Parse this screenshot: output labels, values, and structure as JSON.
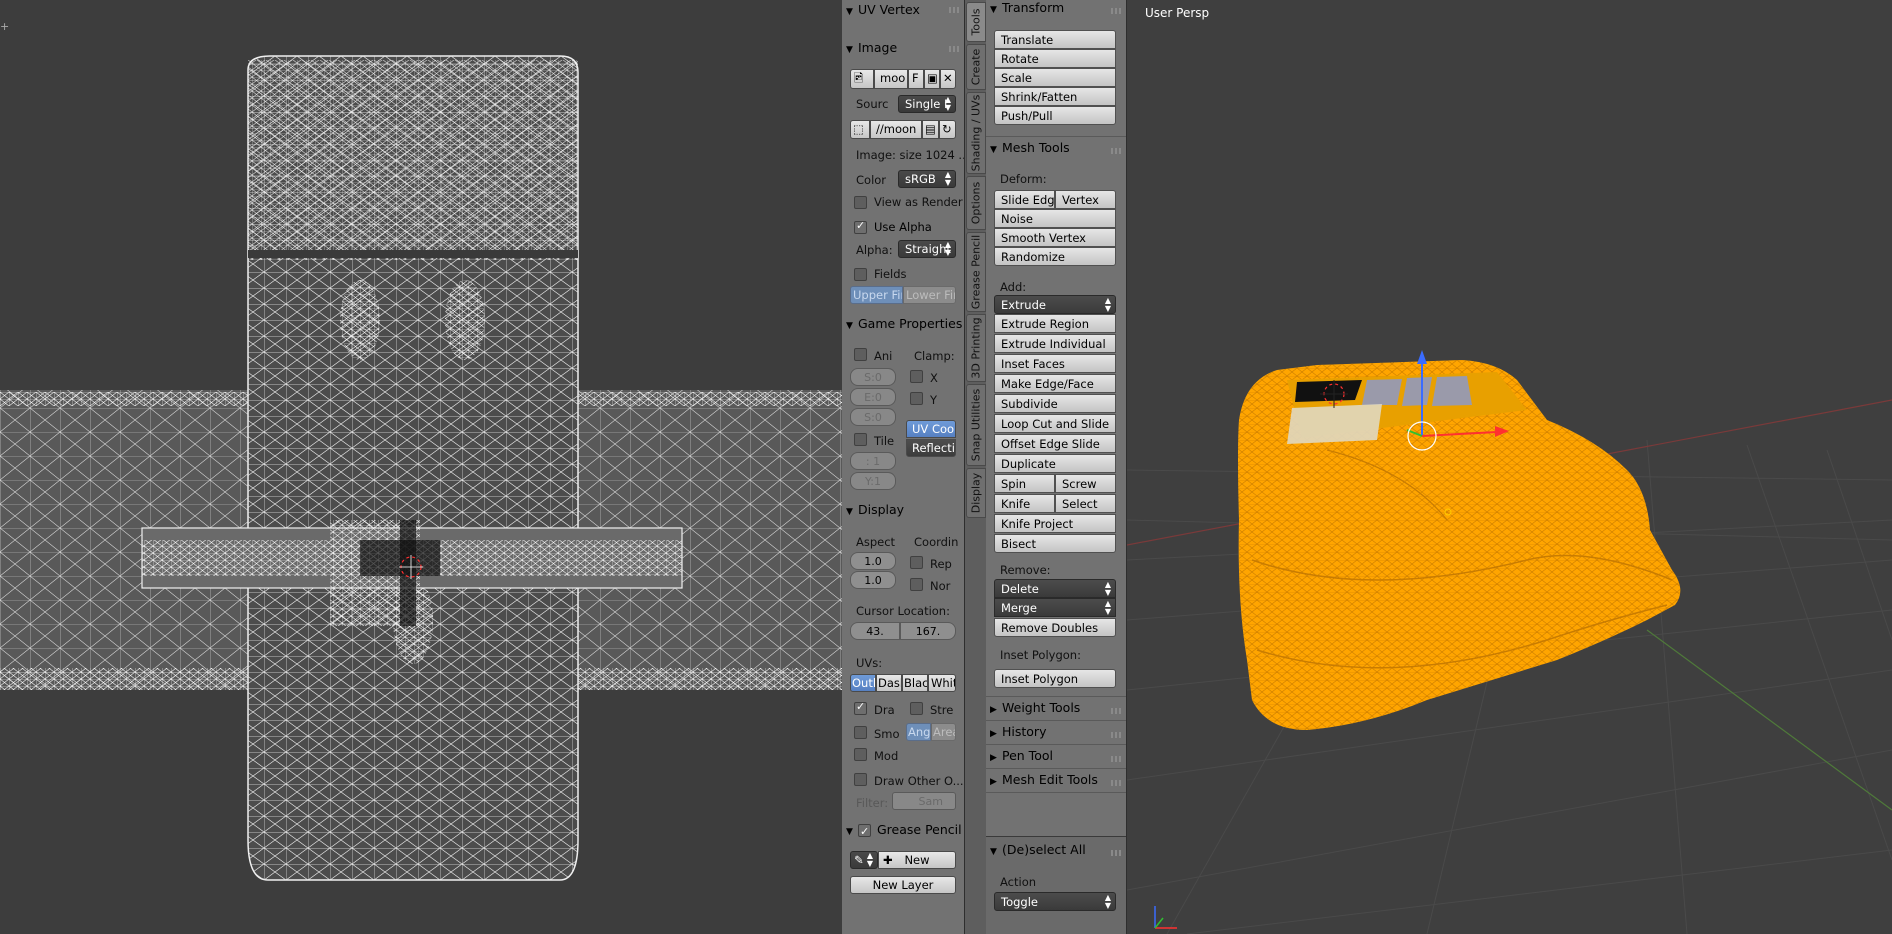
{
  "uv_panel": {
    "uv_vertex_title": "UV Vertex",
    "image_title": "Image",
    "image_name": "moo",
    "image_fake_user": "F",
    "source_label": "Sourc",
    "source_value": "Single I",
    "filepath": "//moon",
    "image_info": "Image: size 1024 ...",
    "color_label": "Color",
    "color_value": "sRGB",
    "view_as_render": "View as Render",
    "use_alpha": "Use Alpha",
    "alpha_label": "Alpha:",
    "alpha_value": "Straight",
    "fields": "Fields",
    "upper_first": "Upper Firs",
    "lower_first": "Lower Firs",
    "game_properties_title": "Game Properties",
    "animated": "Ani",
    "clamp_label": "Clamp:",
    "start_field": "S:0",
    "end_field": "E:0",
    "speed_field": "S:0",
    "clamp_x": "X",
    "clamp_y": "Y",
    "uv_coordinates": "UV Coo",
    "reflection": "Reflecti",
    "tiles": "Tile",
    "tile_x": ": 1",
    "tile_y": "Y:1",
    "display_title": "Display",
    "aspect_label": "Aspect",
    "aspect_x": "1.0",
    "aspect_y": "1.0",
    "coordinates_label": "Coordin",
    "repeat": "Rep",
    "normalized": "Nor",
    "cursor_location_label": "Cursor Location:",
    "cursor_x": "43.",
    "cursor_y": "167.",
    "uvs_label": "UVs:",
    "uv_outline": "Outl",
    "uv_dash": "Dash",
    "uv_black": "Blac",
    "uv_white": "Whit",
    "draw_faces": "Dra",
    "stretch": "Stre",
    "smooth": "Smo",
    "angle": "Angl",
    "area": "Area",
    "modified": "Mod",
    "draw_other_objects": "Draw Other O...",
    "filter_label": "Filter:",
    "filter_value": "Sam",
    "grease_pencil_title": "Grease Pencil",
    "new_button": "New",
    "new_layer_button": "New Layer"
  },
  "tabs": [
    "Tools",
    "Create",
    "Shading / UVs",
    "Options",
    "Grease Pencil",
    "3D Printing",
    "Snap Utilities",
    "Display"
  ],
  "tool_shelf": {
    "transform_title": "Transform",
    "translate": "Translate",
    "rotate": "Rotate",
    "scale": "Scale",
    "shrink_fatten": "Shrink/Fatten",
    "push_pull": "Push/Pull",
    "mesh_tools_title": "Mesh Tools",
    "deform_label": "Deform:",
    "slide_edge": "Slide Edge",
    "vertex": "Vertex",
    "noise": "Noise",
    "smooth_vertex": "Smooth Vertex",
    "randomize": "Randomize",
    "add_label": "Add:",
    "extrude_menu": "Extrude",
    "extrude_region": "Extrude Region",
    "extrude_individual": "Extrude Individual",
    "inset_faces": "Inset Faces",
    "make_edge_face": "Make Edge/Face",
    "subdivide": "Subdivide",
    "loop_cut_slide": "Loop Cut and Slide",
    "offset_edge_slide": "Offset Edge Slide",
    "duplicate": "Duplicate",
    "spin": "Spin",
    "screw": "Screw",
    "knife": "Knife",
    "select": "Select",
    "knife_project": "Knife Project",
    "bisect": "Bisect",
    "remove_label": "Remove:",
    "delete_menu": "Delete",
    "merge_menu": "Merge",
    "remove_doubles": "Remove Doubles",
    "inset_polygon_label": "Inset Polygon:",
    "inset_polygon": "Inset Polygon",
    "weight_tools": "Weight Tools",
    "history": "History",
    "pen_tool": "Pen Tool",
    "mesh_edit_tools": "Mesh Edit Tools",
    "deselect_all_title": "(De)select All",
    "action_label": "Action",
    "action_value": "Toggle"
  },
  "viewport": {
    "view_label": "User Persp",
    "colors": {
      "mesh": "#ffa500",
      "background": "#3f3f3f"
    }
  },
  "colors": {
    "panel": "#727272",
    "active_blue": "#5680c2"
  }
}
